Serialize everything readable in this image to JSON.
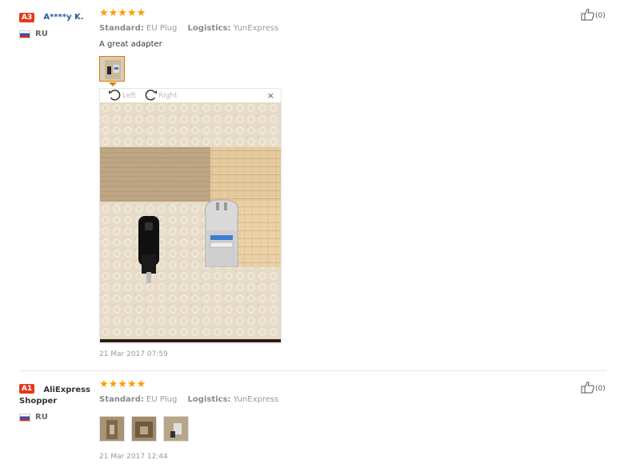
{
  "reviews": [
    {
      "badge": "A3",
      "user": "A****y K.",
      "country": "RU",
      "stars": "★★★★★",
      "standard_label": "Standard:",
      "standard_value": "EU Plug",
      "logistics_label": "Logistics:",
      "logistics_value": "YunExpress",
      "text": "A great adapter",
      "viewer": {
        "left_label": "Left",
        "right_label": "Right",
        "close": "×"
      },
      "date": "21 Mar 2017 07:59",
      "likes": "(0)"
    },
    {
      "badge": "A1",
      "user": "AliExpress",
      "user_line2": "Shopper",
      "country": "RU",
      "stars": "★★★★★",
      "standard_label": "Standard:",
      "standard_value": "EU Plug",
      "logistics_label": "Logistics:",
      "logistics_value": "YunExpress",
      "date": "21 Mar 2017 12:44",
      "likes": "(0)"
    }
  ],
  "colors": {
    "accent": "#ff9a00",
    "badge": "#e4391b",
    "link": "#2b5a9b"
  },
  "icons": [
    "thumbs-up-icon",
    "rotate-left-icon",
    "rotate-right-icon",
    "close-icon",
    "flag-ru-icon"
  ]
}
